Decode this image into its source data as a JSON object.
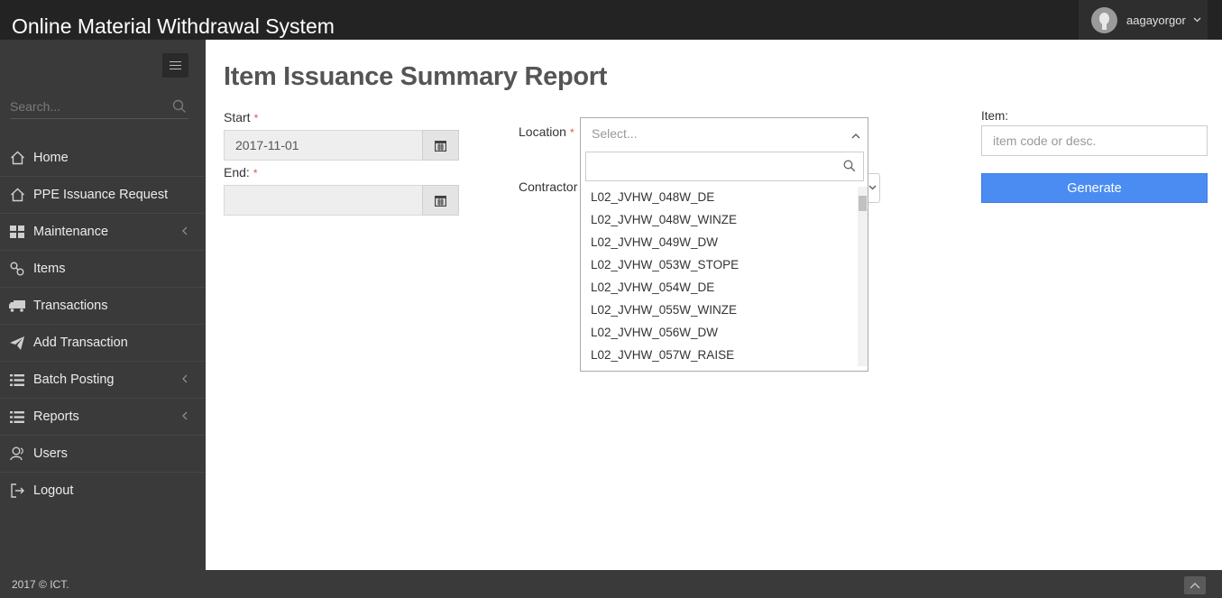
{
  "app": {
    "title": "Online Material Withdrawal System",
    "username": "aagayorgor"
  },
  "sidebar": {
    "search_placeholder": "Search...",
    "items": [
      {
        "label": "Home",
        "icon": "home-icon",
        "submenu": false
      },
      {
        "label": "PPE Issuance Request",
        "icon": "home-icon",
        "submenu": false
      },
      {
        "label": "Maintenance",
        "icon": "grid-icon",
        "submenu": true
      },
      {
        "label": "Items",
        "icon": "link-icon",
        "submenu": false
      },
      {
        "label": "Transactions",
        "icon": "truck-icon",
        "submenu": false
      },
      {
        "label": "Add Transaction",
        "icon": "send-icon",
        "submenu": false
      },
      {
        "label": "Batch Posting",
        "icon": "list-icon",
        "submenu": true
      },
      {
        "label": "Reports",
        "icon": "list-icon",
        "submenu": true
      },
      {
        "label": "Users",
        "icon": "users-icon",
        "submenu": false
      },
      {
        "label": "Logout",
        "icon": "logout-icon",
        "submenu": false
      }
    ]
  },
  "page": {
    "title": "Item Issuance Summary Report"
  },
  "form": {
    "start_label": "Start",
    "start_value": "2017-11-01",
    "end_label": "End:",
    "end_value": "",
    "required_mark": "*",
    "location_label": "Location",
    "location_placeholder": "Select...",
    "contractor_label": "Contractor",
    "item_label": "Item:",
    "item_placeholder": "item code or desc.",
    "generate_label": "Generate"
  },
  "location_dropdown": {
    "search_value": "",
    "options": [
      "L02_JVHW_048W_DE",
      "L02_JVHW_048W_WINZE",
      "L02_JVHW_049W_DW",
      "L02_JVHW_053W_STOPE",
      "L02_JVHW_054W_DE",
      "L02_JVHW_055W_WINZE",
      "L02_JVHW_056W_DW",
      "L02_JVHW_057W_RAISE"
    ]
  },
  "footer": {
    "copyright": "2017 © ICT."
  },
  "colors": {
    "topbar": "#232323",
    "sidebar": "#3a3a3a",
    "accent_button": "#4a8cf1",
    "required": "#d9534f"
  }
}
